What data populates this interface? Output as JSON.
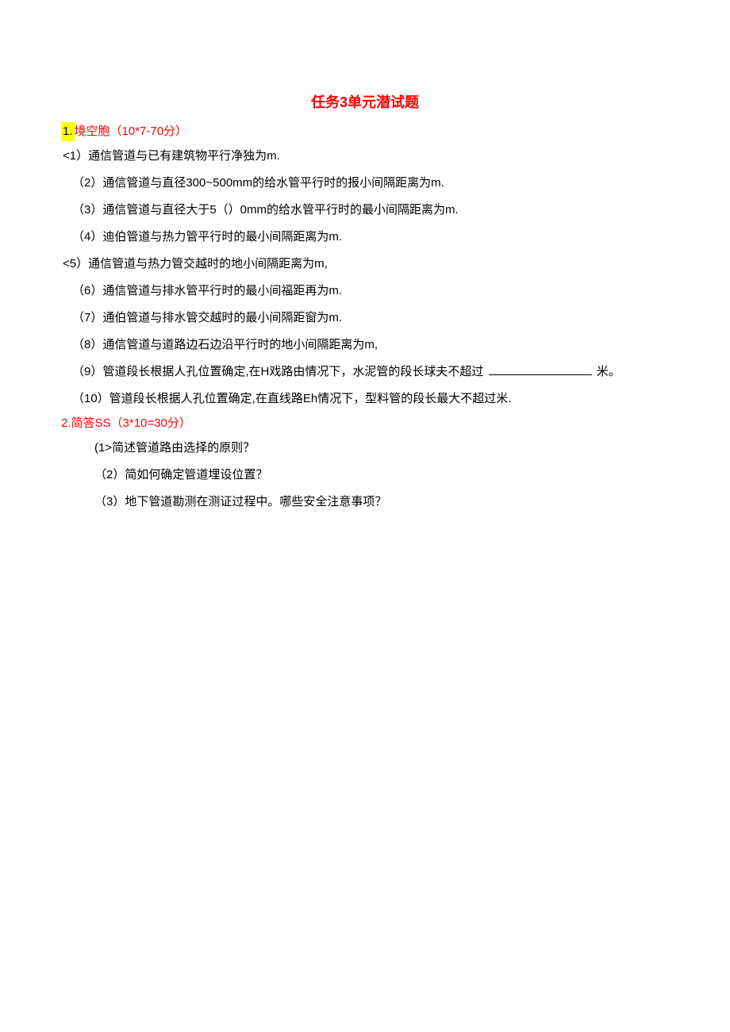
{
  "title": "任务3单元潜试题",
  "section1": {
    "number": "1.",
    "label": "境空胞（10*7-70分）"
  },
  "q1": "<1）通信管道与已有建筑物平行净独为m.",
  "q2": "（2）通信管道与直径300~500mm的给水管平行时的报小间隔距离为m.",
  "q3": "（3）通信管道与直径大于5（）0mm的给水管平行时的最小间隔距离为m.",
  "q4": "（4）迪伯管道与热力管平行时的最小间隔距离为m.",
  "q5": "<5）通信管道与热力管交越时的地小间隔距离为m,",
  "q6": "（6）通信管道与排水管平行时的最小间福距再为m.",
  "q7": "（7）通伯管道与排水管交越时的最小间隔距窗为m.",
  "q8": "（8）通信管道与道路边石边沿平行时的地小间隔距离为m,",
  "q9_pre": "（9）管道段长根据人孔位置确定,在H戏路由情况下，水泥管的段长球夫不超过",
  "q9_post": "米。",
  "q10": "（10）管道段长根据人孔位置确定,在直线路Eh情况下，型料管的段长最大不超过米.",
  "section2": {
    "number": "2.",
    "label": "简答SS（3*10=30分）"
  },
  "sq1": "(1>简述管道路由选择的原则？",
  "sq2": "（2）简如何确定管道埋设位置？",
  "sq3": "（3）地下管道勘测在测证过程中。哪些安全注意事项？"
}
